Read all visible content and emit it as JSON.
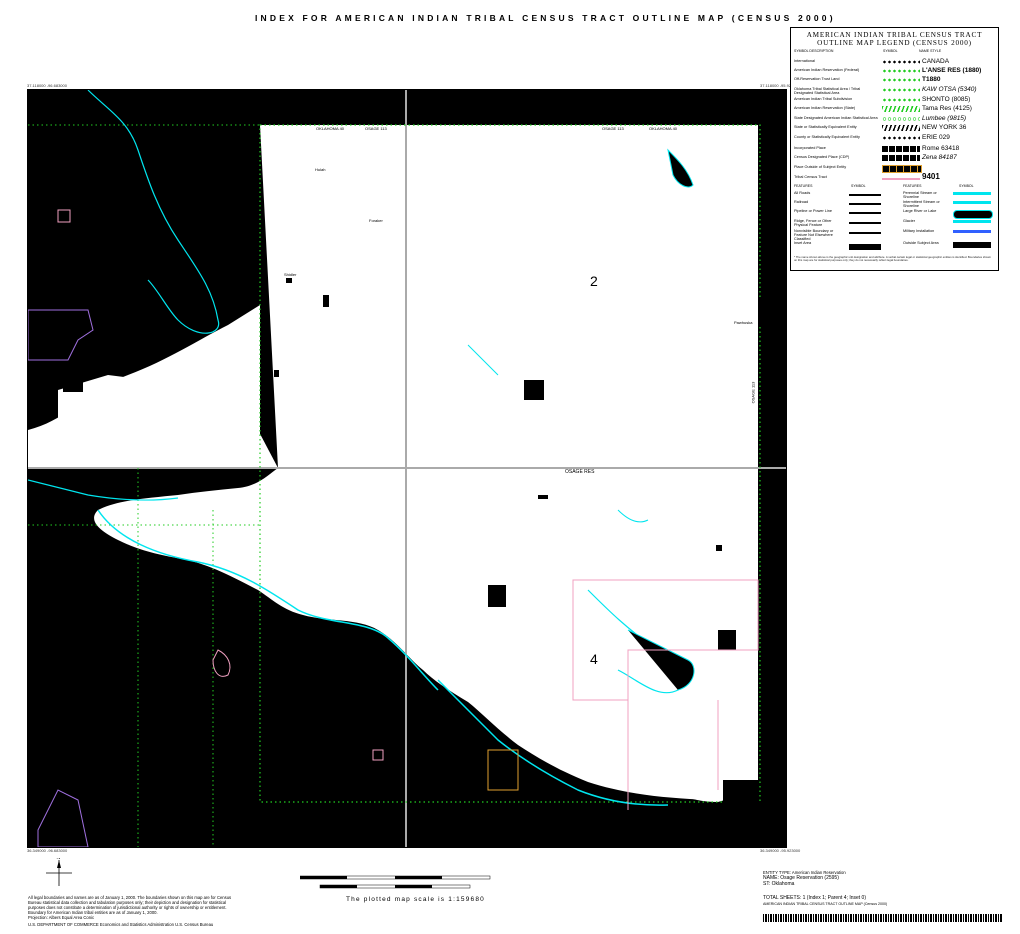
{
  "title": "INDEX FOR AMERICAN INDIAN TRIBAL CENSUS TRACT OUTLINE MAP (CENSUS 2000)",
  "corners": {
    "top_left": "37.118000 -96.683000",
    "top_right": "37.118000 -95.923000",
    "bottom_left": "36.349000 -96.683000",
    "bottom_right": "36.349000 -95.923000"
  },
  "sections": [
    "2",
    "4"
  ],
  "map_labels": {
    "oklahoma_left": "OKLAHOMA 40",
    "osage_left": "OSAGE 113",
    "osage_right": "OSAGE 113",
    "oklahoma_right": "OKLAHOMA 40",
    "osage_res": "OSAGE RES",
    "pawhuska": "Pawhuska",
    "osage_side": "OSAGE 113",
    "hulah": "Hulah",
    "foraker": "Foraker",
    "shidler": "Shidler"
  },
  "legend": {
    "title_line1": "AMERICAN INDIAN TRIBAL CENSUS TRACT",
    "title_line2": "OUTLINE MAP LEGEND (CENSUS 2000)",
    "col_desc": "SYMBOL DESCRIPTION",
    "col_symbol": "SYMBOL",
    "col_name": "NAME STYLE",
    "rows": [
      {
        "desc": "International",
        "name": "CANADA",
        "sym": "dots-black"
      },
      {
        "desc": "American Indian Reservation (Federal)",
        "name": "L'ANSE RES (1880)",
        "sym": "dots-green"
      },
      {
        "desc": "Off-Reservation Trust Land",
        "name": "T1880",
        "sym": "dots-green"
      },
      {
        "desc": "Oklahoma Tribal Statistical Area / Tribal Designated Statistical Area",
        "name": "KAW OTSA (5340)",
        "sym": "dots-green"
      },
      {
        "desc": "American Indian Tribal Subdivision",
        "name": "SHONTO (8085)",
        "sym": "dots-green"
      },
      {
        "desc": "American Indian Reservation (State)",
        "name": "Tama Res (4125)",
        "sym": "dash-green"
      },
      {
        "desc": "State Designated American Indian Statistical Area",
        "name": "Lumbee (9815)",
        "sym": "circle-green"
      },
      {
        "desc": "State or Statistically Equivalent Entity",
        "name": "NEW YORK 36",
        "sym": "dash-black"
      },
      {
        "desc": "County or Statistically Equivalent Entity",
        "name": "ERIE 029",
        "sym": "dots-black"
      },
      {
        "desc": "Incorporated Place",
        "name": "Rome 63418",
        "sym": "box-black"
      },
      {
        "desc": "Census Designated Place (CDP)",
        "name": "Zena 84187",
        "sym": "box-black"
      },
      {
        "desc": "Place Outside of Subject Entity",
        "name": "",
        "sym": "box-orange"
      },
      {
        "desc": "Tribal Census Tract",
        "name": "9401",
        "sym": "pink"
      }
    ],
    "feat_hdr1": "FEATURES",
    "sym_hdr1": "SYMBOL",
    "feat_hdr2": "FEATURES",
    "sym_hdr2": "SYMBOL",
    "features": [
      {
        "left": "All Roads",
        "right": "Perennial Stream or Shoreline"
      },
      {
        "left": "Railroad",
        "right": "Intermittent Stream or Shoreline"
      },
      {
        "left": "Pipeline or Power Line",
        "right": "Large River or Lake"
      },
      {
        "left": "Ridge, Fence or Other Physical Feature",
        "right": "Glacier"
      },
      {
        "left": "Nonvisible Boundary or Feature Not Elsewhere Classified",
        "right": "Military Installation"
      },
      {
        "left": "Inset Area",
        "right": "Outside Subject Area"
      }
    ],
    "note": "* The name shown above is the geographic unit designation and attribute. A verbal certain legal or statistical geographic entities is identified. Boundaries shown on this map are for statistical purposes only; they do not necessarily reflect legal boundaries."
  },
  "footer": {
    "left_notes": [
      "All legal boundaries and names are as of January 1, 2000. The boundaries shown on this map are for Census",
      "Bureau statistical data collection and tabulation purposes only; their depiction and designation for statistical",
      "purposes does not constitute a determination of jurisdictional authority or rights of ownership or entitlement.",
      "Boundary for American Indian tribal entities are as of January 1, 2000.",
      "Projection: Albers Equal Area Conic",
      "U.S. DEPARTMENT OF COMMERCE Economics and Statistics Administration U.S. Census Bureau"
    ],
    "scale_text": "The plotted map scale is 1:159680",
    "entity_type": "ENTITY TYPE: American Indian Reservation",
    "name": "NAME: Osage Reservation (2595)",
    "st": "ST: Oklahoma",
    "total_sheets": "TOTAL SHEETS: 1 (Index 1; Parent 4; Inset 0)",
    "file_line": "AMERICAN INDIAN TRIBAL CENSUS TRACT OUTLINE MAP (Census 2000)"
  },
  "colors": {
    "lake": "#00e5ee",
    "boundary_green": "#22cc22",
    "place_orange": "#e0a030",
    "tract_pink": "#f0a0c0"
  }
}
